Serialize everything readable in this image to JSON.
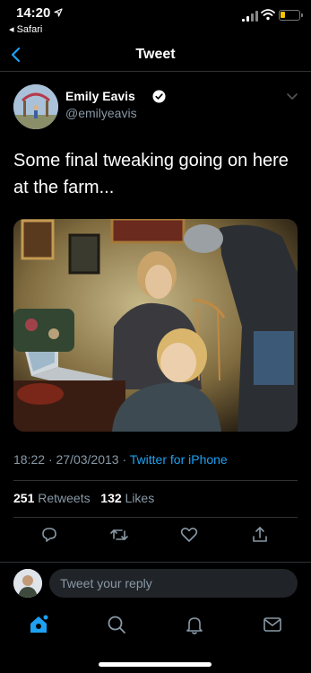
{
  "status_bar": {
    "time": "14:20",
    "back_app": "◂ Safari",
    "icons": [
      "location-arrow-icon",
      "signal-icon",
      "wifi-icon",
      "battery-icon"
    ],
    "battery_color": "#f5c400"
  },
  "nav": {
    "title": "Tweet",
    "back_icon": "chevron-left-icon",
    "accent": "#1da1f2"
  },
  "tweet": {
    "author": {
      "name": "Emily Eavis",
      "handle": "@emilyeavis",
      "verified": true
    },
    "text": "Some final tweaking going on here at the farm...",
    "time": "18:22",
    "separator": "·",
    "date": "27/03/2013",
    "source": "Twitter for iPhone",
    "retweet_count": "251",
    "retweet_label": "Retweets",
    "like_count": "132",
    "like_label": "Likes"
  },
  "actions": [
    "reply-icon",
    "retweet-icon",
    "like-icon",
    "share-icon"
  ],
  "reply": {
    "placeholder": "Tweet your reply"
  },
  "tab_bar": {
    "tabs": [
      "home-icon",
      "search-icon",
      "notifications-icon",
      "messages-icon"
    ],
    "active": "home-icon"
  },
  "colors": {
    "background": "#000000",
    "secondary_text": "#8899a6",
    "divider": "#2f3336"
  }
}
